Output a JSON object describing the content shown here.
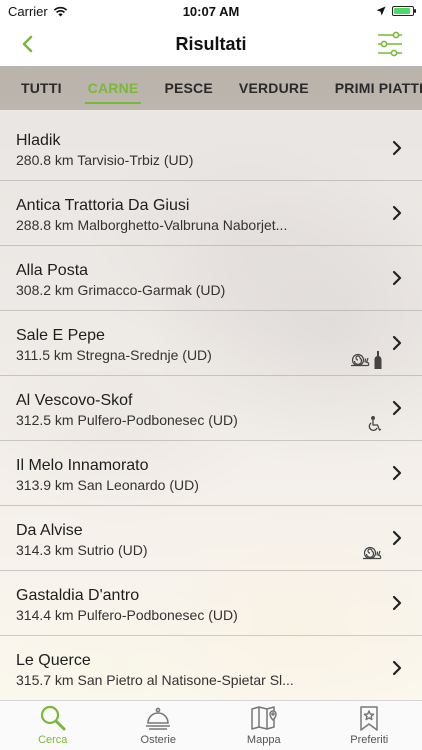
{
  "status_bar": {
    "carrier": "Carrier",
    "time": "10:07 AM",
    "battery_level": 0.9
  },
  "nav": {
    "title": "Risultati",
    "back_icon": "chevron-left-icon",
    "filter_icon": "sliders-icon"
  },
  "colors": {
    "accent": "#7bb83a"
  },
  "tabs": [
    {
      "label": "TUTTI",
      "active": false
    },
    {
      "label": "CARNE",
      "active": true
    },
    {
      "label": "PESCE",
      "active": false
    },
    {
      "label": "VERDURE",
      "active": false
    },
    {
      "label": "PRIMI PIATTI",
      "active": false
    }
  ],
  "results": [
    {
      "name": "Hladik",
      "subtitle": "280.8 km Tarvisio-Trbiz (UD)",
      "badges": []
    },
    {
      "name": "Antica Trattoria Da Giusi",
      "subtitle": "288.8 km Malborghetto-Valbruna Naborjet...",
      "badges": []
    },
    {
      "name": "Alla Posta",
      "subtitle": "308.2 km Grimacco-Garmak (UD)",
      "badges": []
    },
    {
      "name": "Sale E Pepe",
      "subtitle": "311.5 km Stregna-Srednje (UD)",
      "badges": [
        "snail-icon",
        "wine-bottle-icon"
      ]
    },
    {
      "name": "Al Vescovo-Skof",
      "subtitle": "312.5 km Pulfero-Podbonesec (UD)",
      "badges": [
        "wheelchair-icon"
      ]
    },
    {
      "name": "Il Melo Innamorato",
      "subtitle": "313.9 km San Leonardo (UD)",
      "badges": []
    },
    {
      "name": "Da Alvise",
      "subtitle": "314.3 km Sutrio (UD)",
      "badges": [
        "snail-icon"
      ]
    },
    {
      "name": "Gastaldia D'antro",
      "subtitle": "314.4 km Pulfero-Podbonesec (UD)",
      "badges": []
    },
    {
      "name": "Le Querce",
      "subtitle": "315.7 km San Pietro al Natisone-Spietar Sl...",
      "badges": []
    }
  ],
  "tabbar": [
    {
      "label": "Cerca",
      "icon": "search-icon",
      "active": true
    },
    {
      "label": "Osterie",
      "icon": "cloche-icon",
      "active": false
    },
    {
      "label": "Mappa",
      "icon": "map-icon",
      "active": false
    },
    {
      "label": "Preferiti",
      "icon": "bookmark-star-icon",
      "active": false
    }
  ]
}
